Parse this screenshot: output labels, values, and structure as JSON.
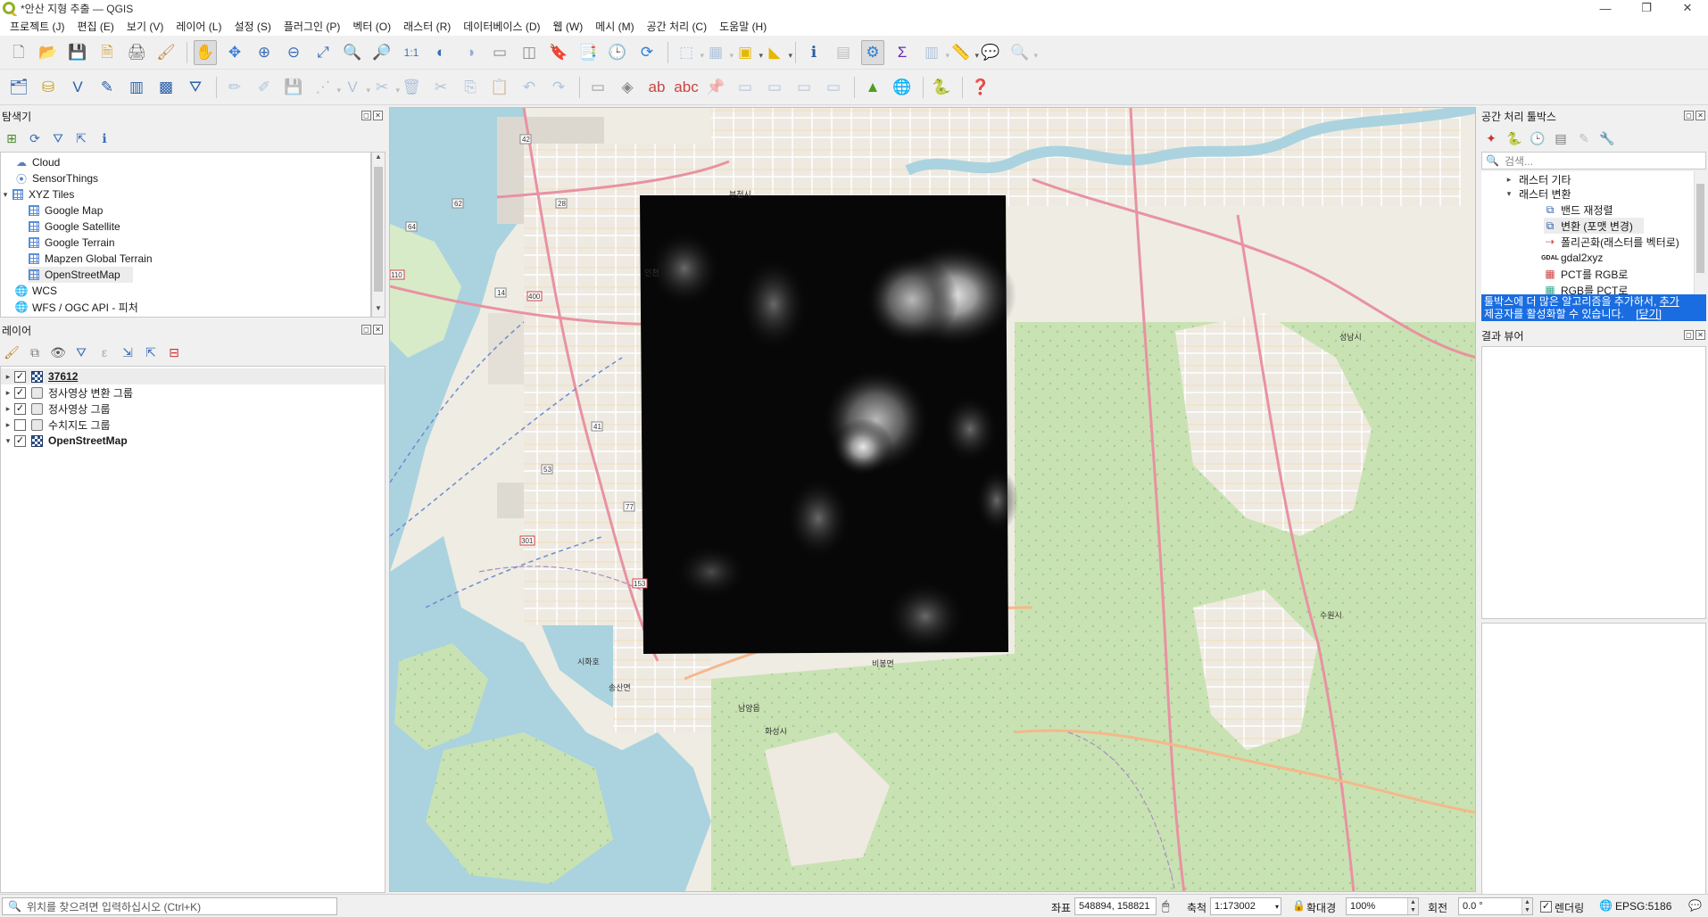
{
  "window": {
    "title": "*안산 지형 추출 — QGIS",
    "minimize": "—",
    "maximize": "❐",
    "close": "✕"
  },
  "menu": [
    "프로젝트 (J)",
    "편집 (E)",
    "보기 (V)",
    "레이어 (L)",
    "설정 (S)",
    "플러그인 (P)",
    "벡터 (O)",
    "래스터 (R)",
    "데이터베이스 (D)",
    "웹 (W)",
    "메시 (M)",
    "공간 처리 (C)",
    "도움말 (H)"
  ],
  "browser": {
    "title": "탐색기",
    "items": [
      {
        "label": "Cloud",
        "icon": "cloud-icon"
      },
      {
        "label": "SensorThings",
        "icon": "sensor-icon"
      },
      {
        "label": "XYZ Tiles",
        "icon": "xyz-tiles-icon"
      },
      {
        "label": "Google Map",
        "icon": "xyz-tiles-icon"
      },
      {
        "label": "Google Satellite",
        "icon": "xyz-tiles-icon"
      },
      {
        "label": "Google Terrain",
        "icon": "xyz-tiles-icon"
      },
      {
        "label": "Mapzen Global Terrain",
        "icon": "xyz-tiles-icon"
      },
      {
        "label": "OpenStreetMap",
        "icon": "xyz-tiles-icon"
      },
      {
        "label": "WCS",
        "icon": "globe-icon"
      },
      {
        "label": "WFS / OGC API - 피처",
        "icon": "globe-icon"
      }
    ]
  },
  "layers": {
    "title": "레이어",
    "items": [
      {
        "label": "37612",
        "checked": true,
        "type": "raster"
      },
      {
        "label": "정사영상 변환 그룹",
        "checked": true,
        "type": "group"
      },
      {
        "label": "정사영상 그룹",
        "checked": true,
        "type": "group"
      },
      {
        "label": "수치지도 그룹",
        "checked": false,
        "type": "group"
      },
      {
        "label": "OpenStreetMap",
        "checked": true,
        "type": "raster"
      }
    ]
  },
  "map_labels": {
    "bucheon": "부천시",
    "incheon": "인천",
    "siheung": "시화호",
    "suwon": "수원시",
    "seongnam": "성남시",
    "bibong": "비봉면",
    "songsan": "송산면",
    "namyang": "남양읍",
    "hwaseong": "화성시",
    "r42": "42",
    "r28": "28",
    "r62": "62",
    "r64": "64",
    "r110": "110",
    "r14": "14",
    "r400": "400",
    "r41": "41",
    "r53": "53",
    "r77": "77",
    "r301": "301",
    "r153": "153"
  },
  "toolbox": {
    "title": "공간 처리 툴박스",
    "search_placeholder": "검색...",
    "items": [
      {
        "label": "래스터 기타",
        "level": 1,
        "arrow": "▸"
      },
      {
        "label": "래스터 변환",
        "level": 1,
        "arrow": "▾"
      },
      {
        "label": "밴드 재정렬",
        "level": 2
      },
      {
        "label": "변환 (포맷 변경)",
        "level": 2
      },
      {
        "label": "폴리곤화(래스터를 벡터로)",
        "level": 2
      },
      {
        "label": "gdal2xyz",
        "level": 2
      },
      {
        "label": "PCT를 RGB로",
        "level": 2
      },
      {
        "label": "RGB를 PCT로",
        "level": 2
      }
    ],
    "banner_text": "툴박스에 더 많은 알고리즘을 추가하서,",
    "banner_link1": "추가",
    "banner_text2": "제공자를 활성화할 수 있습니다.",
    "banner_link2": "[닫기]"
  },
  "results": {
    "title": "결과 뷰어"
  },
  "status": {
    "locator_placeholder": "위치를 찾으려면 입력하십시오 (Ctrl+K)",
    "coord_label": "좌표",
    "coord_value": "548894, 158821",
    "scale_label": "축척",
    "scale_value": "1:173002",
    "magnifier_label": "확대경",
    "magnifier_value": "100%",
    "rotation_label": "회전",
    "rotation_value": "0.0 °",
    "render_label": "렌더링",
    "crs": "EPSG:5186"
  },
  "colors": {
    "water": "#aad3df",
    "land": "#f2efe9",
    "green": "#cfe6bd",
    "road_major": "#f7b2b8",
    "road_primary": "#fcd6a4",
    "selection_blue": "#1a6de0"
  }
}
